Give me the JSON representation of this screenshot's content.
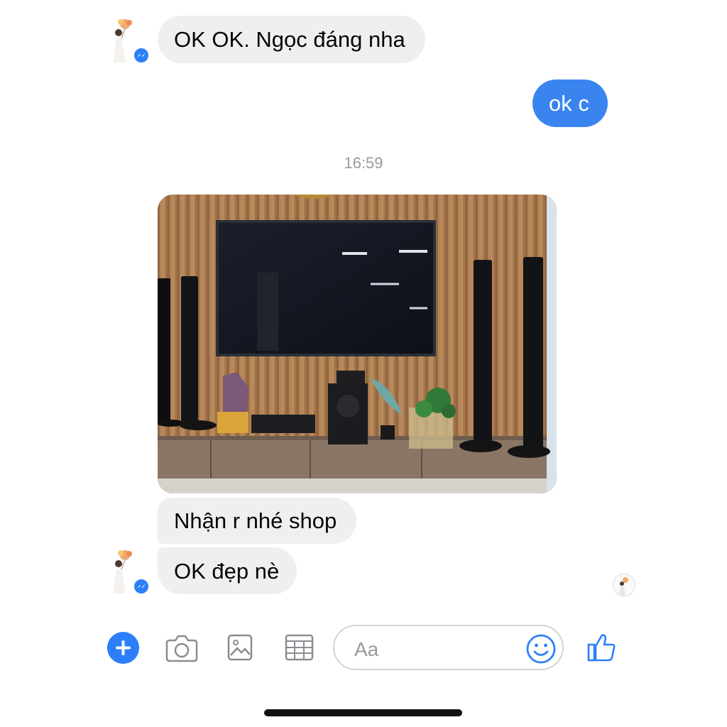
{
  "messages": [
    {
      "sender": "them",
      "text": "OK OK. Ngọc đáng nha"
    },
    {
      "sender": "me",
      "text": "ok c"
    },
    {
      "sender": "them",
      "type": "photo",
      "description_icon": "tv-wall-photo"
    },
    {
      "sender": "them",
      "text": "Nhận r nhé shop"
    },
    {
      "sender": "them",
      "text": "OK đẹp nè"
    }
  ],
  "timestamp": "16:59",
  "composer": {
    "placeholder": "Aa",
    "icons": [
      "plus-icon",
      "camera-icon",
      "gallery-icon",
      "sticker-icon",
      "emoji-icon",
      "like-icon"
    ]
  },
  "colors": {
    "outgoing_bubble": "#3a84f0",
    "incoming_bubble": "#efefef",
    "accent": "#2d7ff9",
    "timestamp": "#9a9a9a"
  }
}
